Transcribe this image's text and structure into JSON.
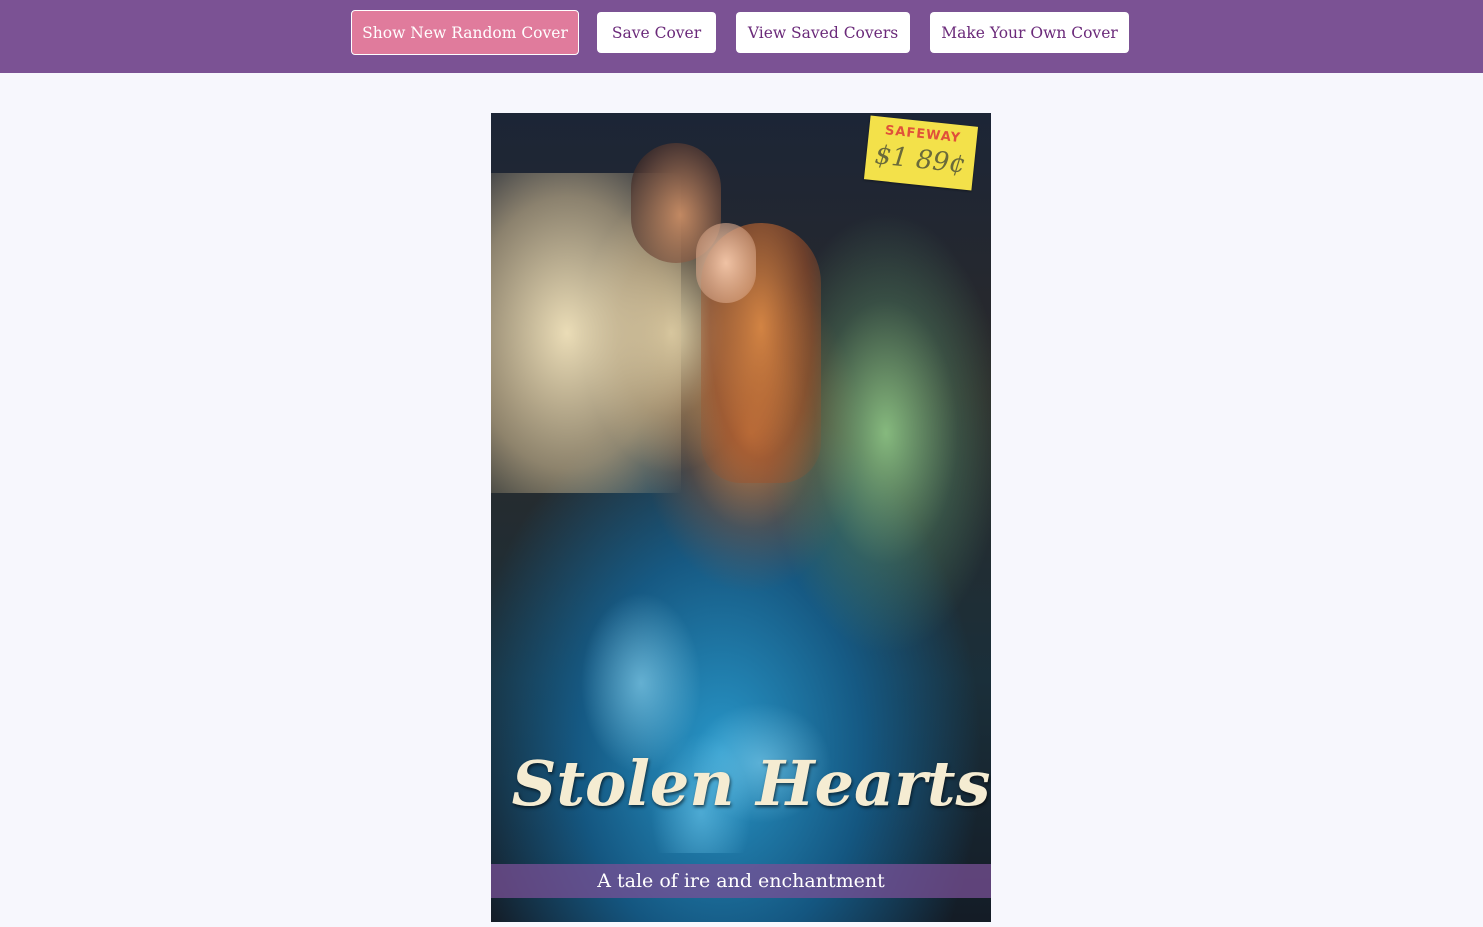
{
  "nav": {
    "buttons": [
      {
        "label": "Show New Random Cover",
        "active": true
      },
      {
        "label": "Save Cover",
        "active": false
      },
      {
        "label": "View Saved Covers",
        "active": false
      },
      {
        "label": "Make Your Own Cover",
        "active": false
      }
    ]
  },
  "cover": {
    "title": "Stolen Hearts",
    "tagline": "A tale of ire and enchantment",
    "sticker": {
      "store": "SAFEWAY",
      "price": "$1 89¢"
    }
  },
  "colors": {
    "nav_bg": "#7b5294",
    "active_button": "#e07b9c",
    "button_text": "#6b2a7a",
    "page_bg": "#f7f7fd",
    "title_color": "#f5ecd2"
  }
}
